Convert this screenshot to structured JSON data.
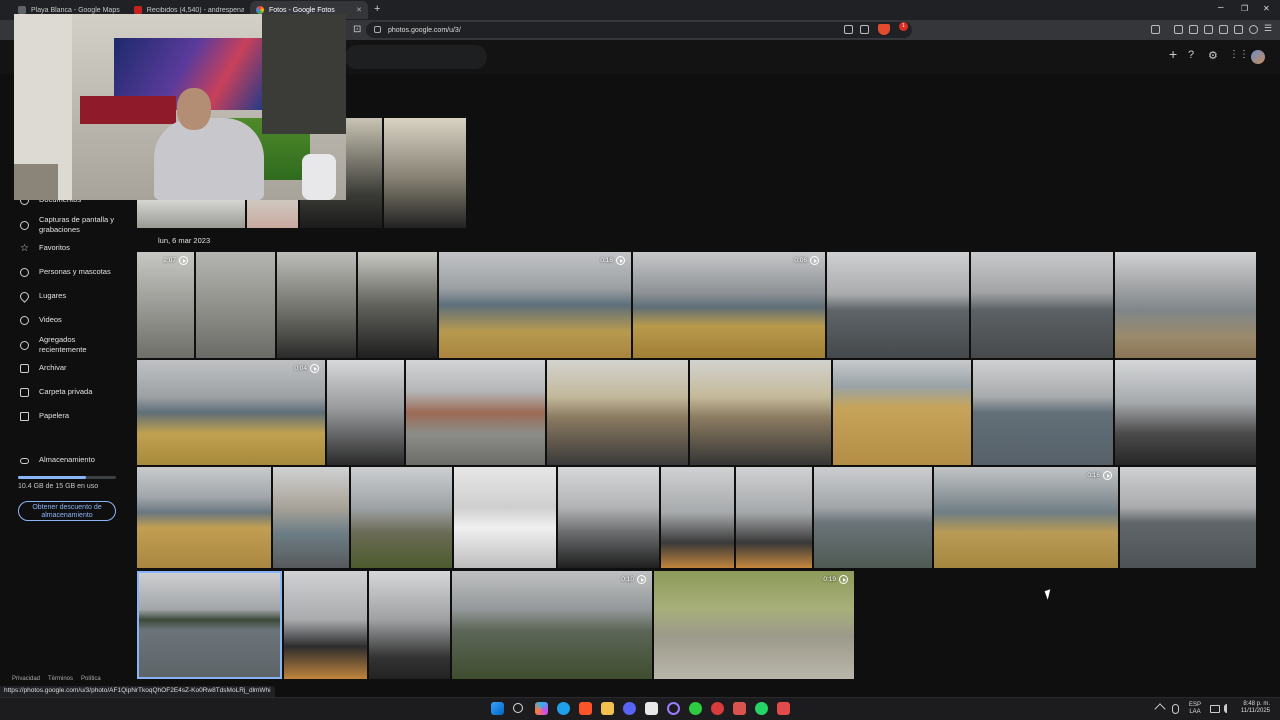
{
  "browser": {
    "tabs": [
      {
        "title": "Playa Blanca - Google Maps"
      },
      {
        "title": "Recibidos (4,540) - andrespenaloza7"
      },
      {
        "title": "Fotos - Google Fotos",
        "active": true
      }
    ],
    "url": "photos.google.com/u/3/",
    "extension_badge": "1",
    "status_url": "https://photos.google.com/u/3/photo/AF1QipNrTkoqQhOF2E4sZ-Ko0Rw8TdsMoLRj_dlmWhi"
  },
  "sidebar": {
    "items": [
      {
        "label": "Documentos",
        "icon": "document-icon"
      },
      {
        "label": "Capturas de pantalla y grabaciones",
        "icon": "screenshot-icon"
      },
      {
        "label": "Favoritos",
        "icon": "star-icon"
      },
      {
        "label": "Personas y mascotas",
        "icon": "people-icon"
      },
      {
        "label": "Lugares",
        "icon": "location-icon"
      },
      {
        "label": "Videos",
        "icon": "video-icon"
      },
      {
        "label": "Agregados recientemente",
        "icon": "recent-icon"
      },
      {
        "label": "Archivar",
        "icon": "archive-icon"
      },
      {
        "label": "Carpeta privada",
        "icon": "lock-folder-icon"
      },
      {
        "label": "Papelera",
        "icon": "trash-icon"
      }
    ],
    "storage": {
      "label": "Almacenamiento",
      "usage": "10.4 GB de 15 GB en uso",
      "used_fraction": 0.69,
      "promo": "Obtener descuento de almacenamiento"
    },
    "footer": [
      "Privacidad",
      "Términos",
      "Política"
    ]
  },
  "gallery": {
    "date_label": "lun, 6 mar 2023",
    "durations": [
      "2:07",
      "0:16",
      "0:06",
      "0:04",
      "0:16",
      "0:10",
      "0:19"
    ]
  },
  "taskbar": {
    "lang": "ESP",
    "lang2": "LAA",
    "time": "8:48 p. m.",
    "date": "11/11/2025"
  },
  "colors": {
    "accent": "#8ab4f8",
    "background": "#0f0f10"
  }
}
